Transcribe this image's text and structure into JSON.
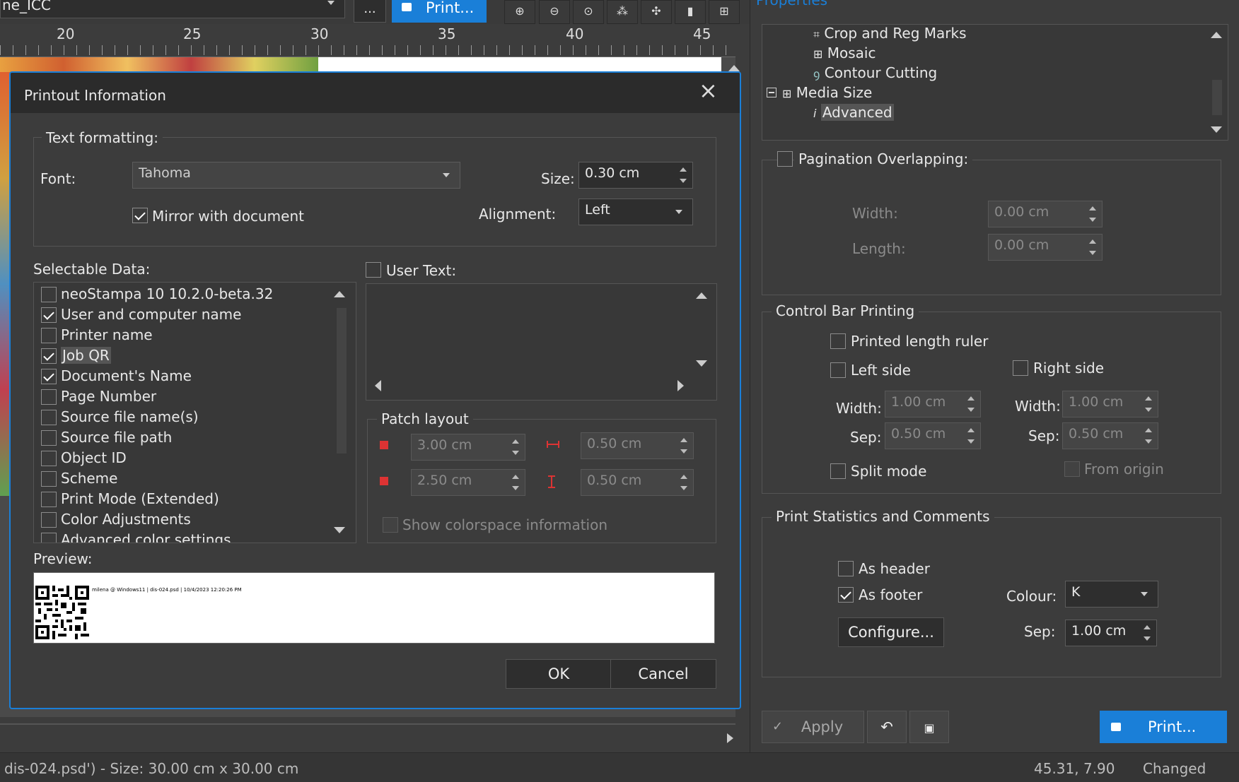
{
  "topbar": {
    "profile_value": "ne_ICC",
    "more_button": "...",
    "print_button": "Print...",
    "tool_icons": [
      "zoom-in-icon",
      "zoom-out-icon",
      "zoom-fit-icon",
      "tile-icon",
      "select-icon",
      "info-icon",
      "grid-icon"
    ]
  },
  "ruler": {
    "ticks": [
      "20",
      "25",
      "30",
      "35",
      "40",
      "45"
    ]
  },
  "properties_title": "Properties",
  "tree": {
    "items": [
      {
        "label": "Crop and Reg Marks",
        "icon": "crop-marks-icon"
      },
      {
        "label": "Mosaic",
        "icon": "mosaic-icon"
      },
      {
        "label": "Contour Cutting",
        "icon": "contour-icon"
      },
      {
        "label": "Media Size",
        "icon": "media-size-icon"
      },
      {
        "label": "Advanced",
        "icon": "info-icon"
      }
    ]
  },
  "pagination": {
    "label": "Pagination Overlapping:",
    "width_label": "Width:",
    "width_value": "0.00 cm",
    "length_label": "Length:",
    "length_value": "0.00 cm"
  },
  "control_bar": {
    "title": "Control Bar Printing",
    "ruler_label": "Printed length ruler",
    "left_side": "Left side",
    "right_side": "Right side",
    "width_label": "Width:",
    "sep_label": "Sep:",
    "left_width": "1.00 cm",
    "left_sep": "0.50 cm",
    "right_width": "1.00 cm",
    "right_sep": "0.50 cm",
    "split_mode": "Split mode",
    "from_origin": "From origin"
  },
  "stats": {
    "title": "Print Statistics and Comments",
    "as_header": "As header",
    "as_footer": "As footer",
    "colour_label": "Colour:",
    "colour_value": "K",
    "configure": "Configure...",
    "sep_label": "Sep:",
    "sep_value": "1.00 cm"
  },
  "bottom_actions": {
    "apply": "Apply",
    "print": "Print..."
  },
  "statusbar": {
    "doc_info": "dis-024.psd') - Size: 30.00 cm x 30.00 cm",
    "coords": "45.31, 7.90",
    "state": "Changed"
  },
  "dialog": {
    "title": "Printout Information",
    "text_formatting": "Text formatting:",
    "font_label": "Font:",
    "font_value": "Tahoma",
    "size_label": "Size:",
    "size_value": "0.30 cm",
    "mirror_label": "Mirror with document",
    "alignment_label": "Alignment:",
    "alignment_value": "Left",
    "selectable_label": "Selectable Data:",
    "selectable_items": [
      {
        "label": "neoStampa 10 10.2.0-beta.32",
        "checked": false
      },
      {
        "label": "User and computer name",
        "checked": true
      },
      {
        "label": "Printer name",
        "checked": false
      },
      {
        "label": "Job QR",
        "checked": true
      },
      {
        "label": "Document's Name",
        "checked": true
      },
      {
        "label": "Page Number",
        "checked": false
      },
      {
        "label": "Source file name(s)",
        "checked": false
      },
      {
        "label": "Source file path",
        "checked": false
      },
      {
        "label": "Object ID",
        "checked": false
      },
      {
        "label": "Scheme",
        "checked": false
      },
      {
        "label": "Print Mode (Extended)",
        "checked": false
      },
      {
        "label": "Color Adjustments",
        "checked": false
      },
      {
        "label": "Advanced color settings",
        "checked": false
      }
    ],
    "user_text_label": "User Text:",
    "patch_layout": "Patch layout",
    "patch_w": "3.00 cm",
    "patch_gap_h": "0.50 cm",
    "patch_h": "2.50 cm",
    "patch_gap_v": "0.50 cm",
    "show_colorspace": "Show colorspace information",
    "preview_label": "Preview:",
    "preview_text": "milena @ Windows11 | dis-024.psd | 10/4/2023 12:20:26 PM",
    "ok": "OK",
    "cancel": "Cancel"
  }
}
